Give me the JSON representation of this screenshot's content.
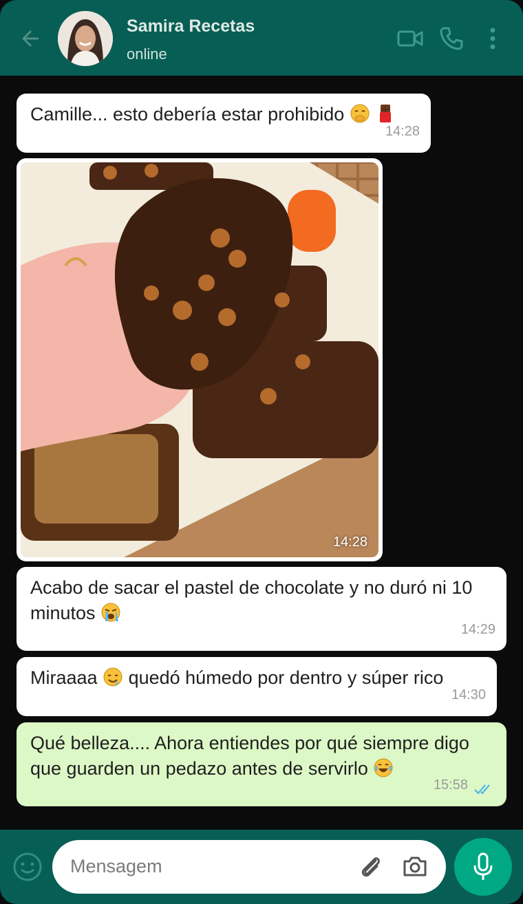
{
  "header": {
    "contact_name": "Samira Recetas",
    "status": "online"
  },
  "messages": [
    {
      "text": "Camille... esto debería estar prohibido",
      "time": "14:28",
      "emojis": [
        "face-with-hand-over-mouth-emoji",
        "chocolate-bar-emoji"
      ]
    },
    {
      "type": "image",
      "time": "14:28"
    },
    {
      "text": "Acabo de sacar el pastel de chocolate y no duró ni 10 minutos",
      "time": "14:29",
      "emojis": [
        "loudly-crying-face-emoji"
      ]
    },
    {
      "text_before": "Miraaaa",
      "text_after": "quedó húmedo por dentro y súper rico",
      "time": "14:30",
      "emojis": [
        "drooling-face-emoji"
      ]
    },
    {
      "text": "Qué belleza.... Ahora entiendes por qué siempre digo que guarden un pedazo antes de servirlo",
      "time": "15:58",
      "emojis": [
        "face-with-tears-of-joy-emoji"
      ],
      "read_status": "double-check-read"
    }
  ],
  "footer": {
    "input_placeholder": "Mensagem"
  },
  "colors": {
    "header_bg": "#075e54",
    "outgoing_bubble": "#dcf8c6",
    "incoming_bubble": "#ffffff",
    "mic_button": "#00a884",
    "read_ticks": "#4fb6ec"
  }
}
